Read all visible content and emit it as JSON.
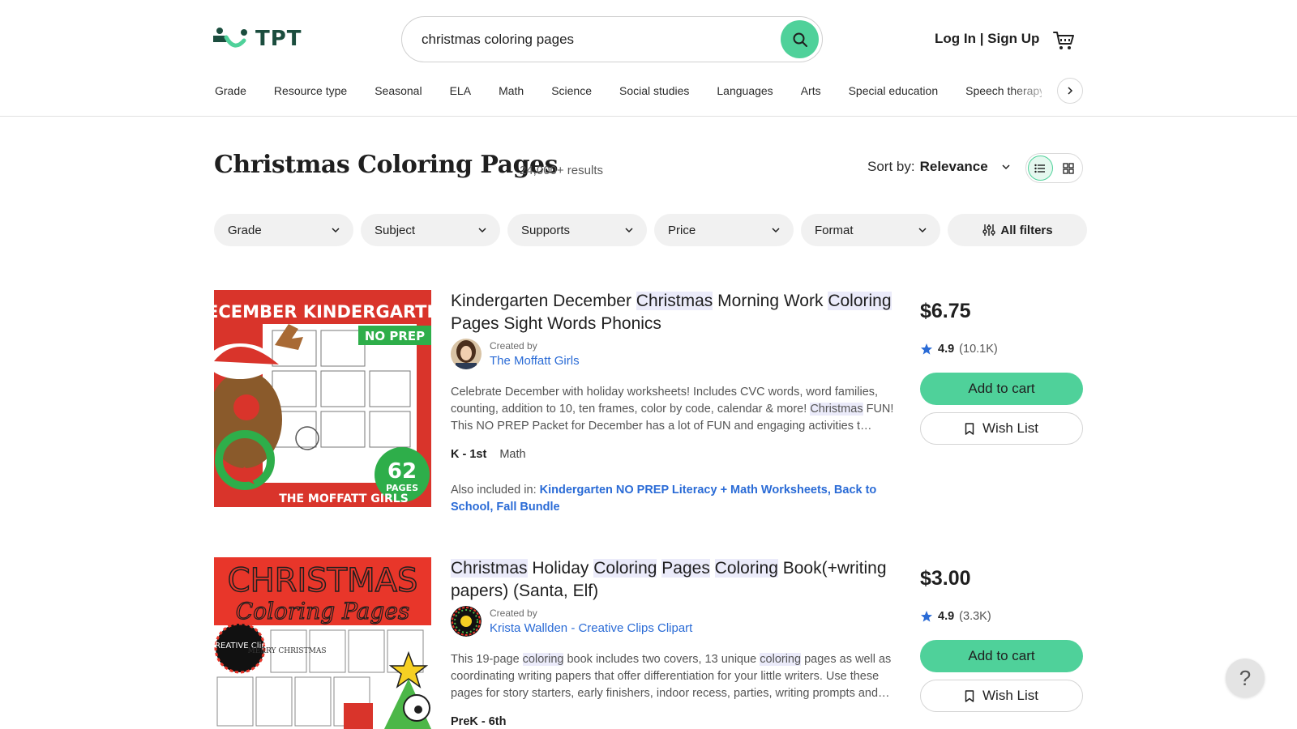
{
  "header": {
    "logo_text": "TPT",
    "search": {
      "value": "christmas coloring pages"
    },
    "auth_label": "Log In | Sign Up"
  },
  "nav": {
    "items": [
      "Grade",
      "Resource type",
      "Seasonal",
      "ELA",
      "Math",
      "Science",
      "Social studies",
      "Languages",
      "Arts",
      "Special education",
      "Speech therapy"
    ]
  },
  "results": {
    "title": "Christmas Coloring Pages",
    "count": "24,000+ results",
    "sort_label": "Sort by:",
    "sort_value": "Relevance"
  },
  "filters": [
    "Grade",
    "Subject",
    "Supports",
    "Price",
    "Format"
  ],
  "all_filters_label": "All filters",
  "products": [
    {
      "title_parts": [
        {
          "text": "Kindergarten December ",
          "hl": false
        },
        {
          "text": "Christmas",
          "hl": true
        },
        {
          "text": " Morning Work ",
          "hl": false
        },
        {
          "text": "Coloring",
          "hl": true
        },
        {
          "text": " Pages Sight Words Phonics",
          "hl": false
        }
      ],
      "created_by_label": "Created by",
      "creator": "The Moffatt Girls",
      "description_parts": [
        {
          "text": "Celebrate December with holiday worksheets! Includes CVC words, word families, counting, addition to 10, ten frames, color by code, calendar & more! ",
          "hl": false
        },
        {
          "text": "Christmas",
          "hl": true
        },
        {
          "text": " FUN! This NO PREP Packet for December has a lot of FUN and engaging activities t…",
          "hl": false
        }
      ],
      "grade": "K - 1st",
      "subject": "Math",
      "also_label": "Also included in: ",
      "also_links": "Kindergarten NO PREP Literacy + Math Worksheets, Back to School, Fall Bundle",
      "price": "$6.75",
      "rating": "4.9",
      "rating_count": "(10.1K)",
      "add_to_cart": "Add to cart",
      "wish_list": "Wish List",
      "thumb": {
        "headline": "DECEMBER KINDERGARTEN",
        "badge": "NO PREP",
        "pages_number": "62",
        "pages_label": "PAGES",
        "footer": "THE MOFFATT GIRLS"
      }
    },
    {
      "title_parts": [
        {
          "text": "Christmas",
          "hl": true
        },
        {
          "text": " Holiday ",
          "hl": false
        },
        {
          "text": "Coloring",
          "hl": true
        },
        {
          "text": " ",
          "hl": false
        },
        {
          "text": "Pages",
          "hl": true
        },
        {
          "text": " ",
          "hl": false
        },
        {
          "text": "Coloring",
          "hl": true
        },
        {
          "text": " Book(+writing papers) (Santa, Elf)",
          "hl": false
        }
      ],
      "created_by_label": "Created by",
      "creator": "Krista Wallden - Creative Clips Clipart",
      "description_parts": [
        {
          "text": "This 19-page ",
          "hl": false
        },
        {
          "text": "coloring",
          "hl": true
        },
        {
          "text": " book includes two covers, 13 unique ",
          "hl": false
        },
        {
          "text": "coloring",
          "hl": true
        },
        {
          "text": " pages as well as coordinating writing papers that offer differentiation for your little writers. Use these pages for story starters, early finishers, indoor recess, parties, writing prompts and…",
          "hl": false
        }
      ],
      "grade": "PreK - 6th",
      "price": "$3.00",
      "rating": "4.9",
      "rating_count": "(3.3K)",
      "add_to_cart": "Add to cart",
      "wish_list": "Wish List",
      "thumb": {
        "headline": "CHRISTMAS",
        "subheadline": "Coloring Pages",
        "badge": "CREATIVE Clips",
        "card_text": "MERRY CHRISTMAS"
      }
    }
  ],
  "help_label": "?",
  "colors": {
    "accent": "#4fd19a",
    "link": "#2a6bd6",
    "highlight": "#ebebfa",
    "star": "#2a6bd6"
  }
}
